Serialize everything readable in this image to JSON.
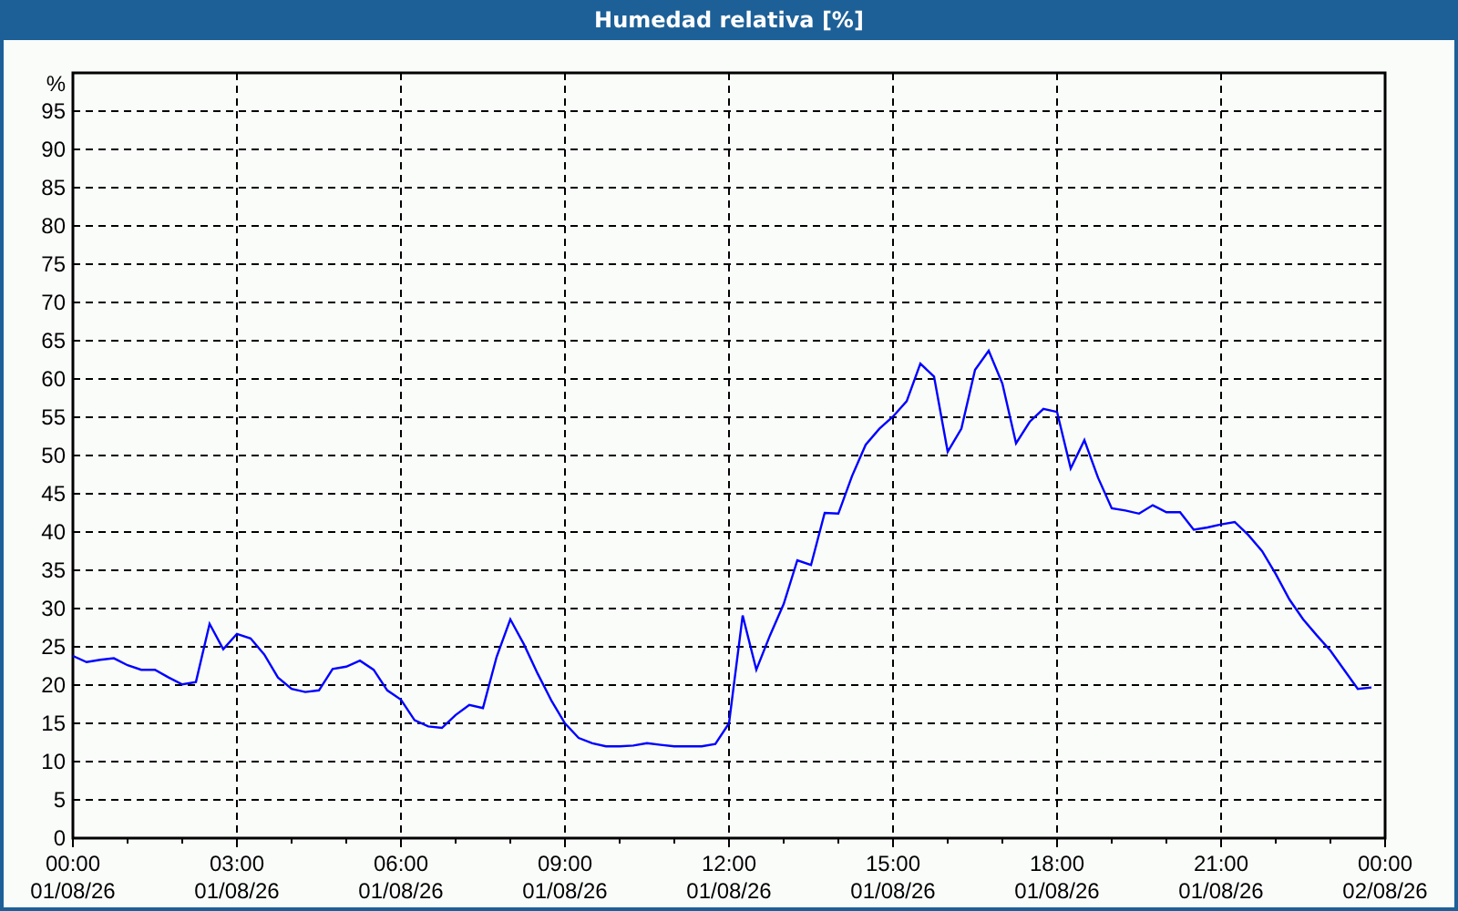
{
  "window": {
    "title": "Humedad relativa [%]"
  },
  "chart": {
    "chart_data": {
      "type": "line",
      "grid": true,
      "ylabel": "%",
      "ylim": [
        0,
        100
      ],
      "yticks": [
        0,
        5,
        10,
        15,
        20,
        25,
        30,
        35,
        40,
        45,
        50,
        55,
        60,
        65,
        70,
        75,
        80,
        85,
        90,
        95
      ],
      "categories": [
        "00:00\n01/08/26",
        null,
        null,
        null,
        null,
        null,
        null,
        null,
        null,
        null,
        null,
        null,
        "03:00\n01/08/26",
        null,
        null,
        null,
        null,
        null,
        null,
        null,
        null,
        null,
        null,
        null,
        "06:00\n01/08/26",
        null,
        null,
        null,
        null,
        null,
        null,
        null,
        null,
        null,
        null,
        null,
        "09:00\n01/08/26",
        null,
        null,
        null,
        null,
        null,
        null,
        null,
        null,
        null,
        null,
        null,
        "12:00\n01/08/26",
        null,
        null,
        null,
        null,
        null,
        null,
        null,
        null,
        null,
        null,
        null,
        "15:00\n01/08/26",
        null,
        null,
        null,
        null,
        null,
        null,
        null,
        null,
        null,
        null,
        null,
        "18:00\n01/08/26",
        null,
        null,
        null,
        null,
        null,
        null,
        null,
        null,
        null,
        null,
        null,
        "21:00\n01/08/26",
        null,
        null,
        null,
        null,
        null,
        null,
        null,
        null,
        null,
        null,
        null,
        "00:00\n02/08/26"
      ],
      "series": [
        {
          "color": "#0000ff",
          "values": [
            23.8,
            23,
            23.3,
            23.5,
            22.6,
            22,
            22,
            21,
            20.1,
            20.4,
            28,
            24.7,
            26.7,
            26.1,
            24,
            21,
            19.5,
            19.1,
            19.3,
            22.1,
            22.4,
            23.2,
            22,
            19.3,
            18.1,
            15.4,
            14.6,
            14.4,
            16.1,
            17.4,
            17,
            23.7,
            28.6,
            25.3,
            21.5,
            18,
            15,
            13.1,
            12.4,
            12,
            12,
            12.1,
            12.4,
            12.2,
            12,
            12,
            12,
            12.3,
            15,
            29.1,
            22,
            26.5,
            30.6,
            36.3,
            35.7,
            42.5,
            42.4,
            47.3,
            51.4,
            53.5,
            55.1,
            57.1,
            62,
            60.3,
            50.5,
            53.5,
            61.2,
            63.7,
            59.4,
            51.6,
            54.4,
            56.1,
            55.7,
            48.3,
            52,
            47.1,
            43.1,
            42.8,
            42.4,
            43.5,
            42.6,
            42.6,
            40.3,
            40.6,
            41,
            41.3,
            39.6,
            37.5,
            34.5,
            31.2,
            28.6,
            26.5,
            24.5,
            22,
            19.5,
            19.7,
            null
          ]
        }
      ]
    }
  }
}
